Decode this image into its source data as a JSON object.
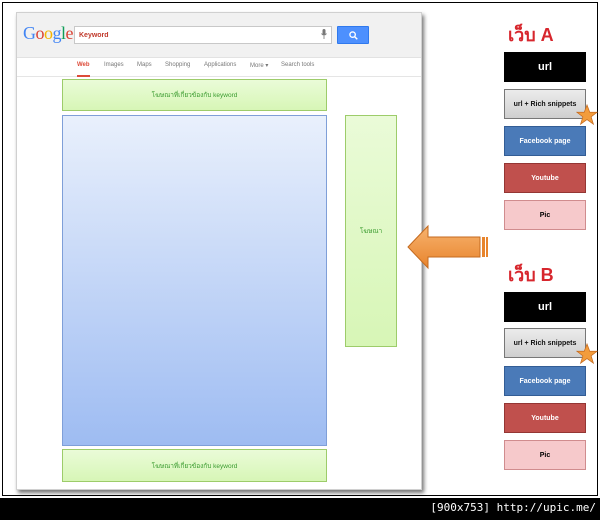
{
  "serp": {
    "logo": "Google",
    "search_value": "Keyword",
    "tabs": [
      "Web",
      "Images",
      "Maps",
      "Shopping",
      "Applications",
      "More ▾",
      "Search tools"
    ],
    "ad_top_label": "โฆษณาที่เกี่ยวข้องกับ keyword",
    "ad_bottom_label": "โฆษณาที่เกี่ยวข้องกับ keyword",
    "ad_right_label": "โฆษณา"
  },
  "legend": {
    "site_a_title": "เว็บ A",
    "site_b_title": "เว็บ B",
    "a": {
      "url": "url",
      "rich": "url + Rich snippets",
      "facebook": "Facebook page",
      "youtube": "Youtube",
      "pic": "Pic"
    },
    "b": {
      "url": "url",
      "rich": "url + Rich snippets",
      "facebook": "Facebook page",
      "youtube": "Youtube",
      "pic": "Pic"
    }
  },
  "watermark": "[900x753] http://upic.me/",
  "colors": {
    "google_blue": "#4285f4",
    "google_red": "#db4437",
    "google_yellow": "#f4b400",
    "google_green": "#0f9d58",
    "arrow_orange": "#f29a4a",
    "star_orange": "#f39c3c",
    "title_red": "#d7262d"
  }
}
